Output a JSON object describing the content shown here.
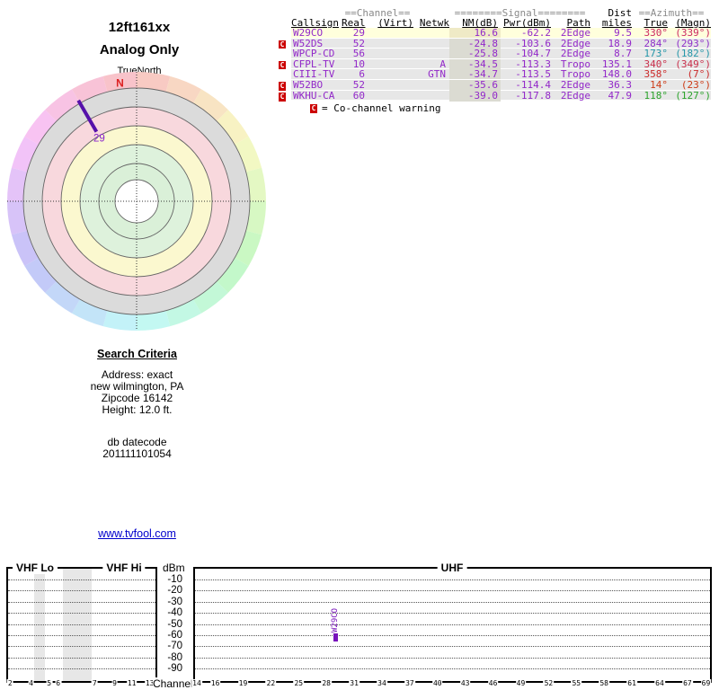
{
  "header": {
    "title": "12ft161xx",
    "subtitle": "Analog Only"
  },
  "polar_chart": {
    "axis_label": "TrueNorth",
    "north_marker": "N",
    "north_color": "#dd2222",
    "ring_radii": [
      24,
      42,
      63,
      84,
      105,
      126
    ],
    "ring_fills": [
      "#ffffff",
      "#daf0d8",
      "#def2dc",
      "#fbf8cf",
      "#f8d8dd",
      "#dbdbdb"
    ],
    "wheel": {
      "inner_radius": 126,
      "outer_radius": 144,
      "segments": 24,
      "saturation": 80,
      "lightness": 87
    },
    "line_color": "#5511aa",
    "label_color": "#8822cc"
  },
  "table": {
    "group_headers": {
      "channel": "==Channel==",
      "signal": "========Signal========",
      "dist": "Dist",
      "azimuth": "==Azimuth=="
    },
    "columns": {
      "callsign": "Callsign",
      "real": "Real",
      "virt": "(Virt)",
      "netwk": "Netwk",
      "nm": "NM(dB)",
      "pwr": "Pwr(dBm)",
      "path": "Path",
      "miles": "miles",
      "true": "True",
      "magn": "(Magn)"
    },
    "value_color": "#9228c9",
    "warn_bg": "#cc0000",
    "warn_symbol": "C",
    "rows": [
      {
        "co": false,
        "callsign": "W29CO",
        "real": "29",
        "virt": "",
        "netwk": "",
        "nm": "16.6",
        "pwr": "-62.2",
        "path": "2Edge",
        "miles": "9.5",
        "true": "330°",
        "magn": "(339°)",
        "az_color": "#cc2963",
        "bg": "#ffffdc",
        "nm_bg": "#efeac6"
      },
      {
        "co": true,
        "callsign": "W52DS",
        "real": "52",
        "virt": "",
        "netwk": "",
        "nm": "-24.8",
        "pwr": "-103.6",
        "path": "2Edge",
        "miles": "18.9",
        "true": "284°",
        "magn": "(293°)",
        "az_color": "#8e2fc9",
        "bg": "#e7e7e7",
        "nm_bg": "#dbdbd2"
      },
      {
        "co": false,
        "callsign": "WPCP-CD",
        "real": "56",
        "virt": "",
        "netwk": "",
        "nm": "-25.8",
        "pwr": "-104.7",
        "path": "2Edge",
        "miles": "8.7",
        "true": "173°",
        "magn": "(182°)",
        "az_color": "#2496a8",
        "bg": "#e7e7e7",
        "nm_bg": "#dbdbd2"
      },
      {
        "co": true,
        "callsign": "CFPL-TV",
        "real": "10",
        "virt": "",
        "netwk": "A",
        "nm": "-34.5",
        "pwr": "-113.3",
        "path": "Tropo",
        "miles": "135.1",
        "true": "340°",
        "magn": "(349°)",
        "az_color": "#c92f4b",
        "bg": "#e7e7e7",
        "nm_bg": "#dbdbd2"
      },
      {
        "co": false,
        "callsign": "CIII-TV",
        "real": "6",
        "virt": "",
        "netwk": "GTN",
        "nm": "-34.7",
        "pwr": "-113.5",
        "path": "Tropo",
        "miles": "148.0",
        "true": "358°",
        "magn": "(7°)",
        "az_color": "#cb2a2a",
        "bg": "#e7e7e7",
        "nm_bg": "#dbdbd2"
      },
      {
        "co": true,
        "callsign": "W52BO",
        "real": "52",
        "virt": "",
        "netwk": "",
        "nm": "-35.6",
        "pwr": "-114.4",
        "path": "2Edge",
        "miles": "36.3",
        "true": "14°",
        "magn": "(23°)",
        "az_color": "#cc3b17",
        "bg": "#e7e7e7",
        "nm_bg": "#dbdbd2"
      },
      {
        "co": true,
        "callsign": "WKHU-CA",
        "real": "60",
        "virt": "",
        "netwk": "",
        "nm": "-39.0",
        "pwr": "-117.8",
        "path": "2Edge",
        "miles": "47.9",
        "true": "118°",
        "magn": "(127°)",
        "az_color": "#2ba32b",
        "bg": "#e7e7e7",
        "nm_bg": "#dbdbd2"
      }
    ],
    "legend_text": "= Co-channel warning"
  },
  "search": {
    "heading": "Search Criteria",
    "lines": [
      "Address: exact",
      "new wilmington, PA",
      "Zipcode 16142",
      "Height: 12.0 ft."
    ],
    "db_label": "db datecode",
    "db_value": "201111101054"
  },
  "link": {
    "text": "www.tvfool.com",
    "color": "#0000cc"
  },
  "bottom_chart_labels": {
    "vhf_lo": "VHF Lo",
    "vhf_hi": "VHF Hi",
    "uhf": "UHF",
    "dbm": "dBm",
    "channel": "Channel"
  },
  "chart_data": [
    {
      "type": "scatter",
      "subtype": "polar-azimuth-rings",
      "title": "12ft161xx",
      "subtitle": "Analog Only",
      "north_label": "TrueNorth",
      "north_marker_azimuth_deg": 352,
      "rings": "concentric signal-strength zones, outer band is azimuth hue wheel (hue = azimuth)",
      "points": [
        {
          "callsign": "W29CO",
          "channel_label": "29",
          "azimuth_true_deg": 330,
          "r_inner_frac": 0.62,
          "r_outer_frac": 0.9
        }
      ]
    },
    {
      "type": "scatter",
      "title": "",
      "xlabel": "Channel",
      "ylabel": "dBm",
      "ylim": [
        -95,
        -5
      ],
      "yticks": [
        -10,
        -20,
        -30,
        -40,
        -50,
        -60,
        -70,
        -80,
        -90
      ],
      "grid": "horizontal dotted",
      "panels": [
        {
          "name": "VHF",
          "top_labels": [
            "VHF Lo",
            "VHF Hi"
          ],
          "ticks": [
            {
              "ch": "2",
              "x": 2.3
            },
            {
              "ch": "4",
              "x": 25.5
            },
            {
              "ch": "5",
              "x": 45.7
            },
            {
              "ch": "6",
              "x": 55.7
            },
            {
              "ch": "7",
              "x": 96.3
            },
            {
              "ch": "9",
              "x": 118.5
            },
            {
              "ch": "11",
              "x": 137.7
            },
            {
              "ch": "13",
              "x": 157.7
            }
          ],
          "shaded_bands": [
            {
              "x": 29,
              "w": 12
            },
            {
              "x": 61,
              "w": 32
            }
          ]
        },
        {
          "name": "UHF",
          "top_labels": [
            "UHF"
          ],
          "channels": [
            14,
            16,
            19,
            22,
            25,
            28,
            31,
            34,
            37,
            40,
            43,
            46,
            49,
            52,
            55,
            58,
            61,
            64,
            67,
            69
          ]
        }
      ],
      "points": [
        {
          "label": "W29CO",
          "x": 29,
          "y": -62.2,
          "color": "#7711bb"
        }
      ]
    }
  ]
}
